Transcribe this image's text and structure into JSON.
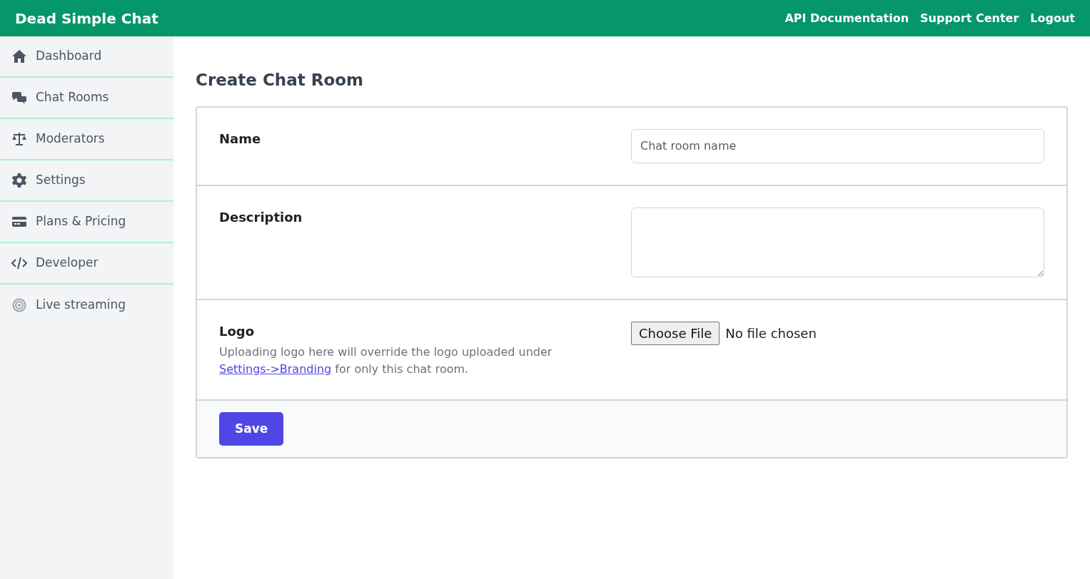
{
  "navbar": {
    "brand": "Dead Simple Chat",
    "links": [
      "API Documentation",
      "Support Center",
      "Logout"
    ]
  },
  "sidebar": {
    "items": [
      {
        "label": "Dashboard"
      },
      {
        "label": "Chat Rooms"
      },
      {
        "label": "Moderators"
      },
      {
        "label": "Settings"
      },
      {
        "label": "Plans & Pricing"
      },
      {
        "label": "Developer"
      },
      {
        "label": "Live streaming"
      }
    ]
  },
  "page_title": "Create Chat Room",
  "form": {
    "fields": [
      {
        "kind": "text",
        "label": "Name",
        "placeholder": "Chat room name"
      },
      {
        "kind": "textarea",
        "label": "Description"
      },
      {
        "kind": "file",
        "label": "Logo",
        "help_before": "Uploading logo here will override the logo uploaded under",
        "help_link": "Settings->Branding",
        "help_after": "for only this chat room.",
        "button": "Choose File",
        "status": "No file chosen"
      }
    ],
    "save": "Save"
  }
}
